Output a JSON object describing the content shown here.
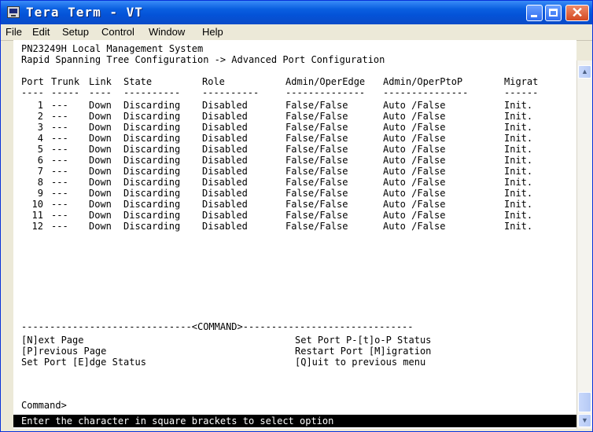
{
  "window": {
    "title": "Tera Term - VT"
  },
  "menubar": [
    "File",
    "Edit",
    "Setup",
    "Control",
    "Window",
    "Help"
  ],
  "terminal": {
    "header_line1": "PN23249H Local Management System",
    "header_line2": "Rapid Spanning Tree Configuration -> Advanced Port Configuration",
    "columns": {
      "port": "Port",
      "trunk": "Trunk",
      "link": "Link",
      "state": "State",
      "role": "Role",
      "edge": "Admin/OperEdge",
      "ptop": "Admin/OperPtoP",
      "migrat": "Migrat"
    },
    "underlines": {
      "port": "----",
      "trunk": "-----",
      "link": "----",
      "state": "----------",
      "role": "----------",
      "edge": "--------------",
      "ptop": "---------------",
      "migrat": "------"
    },
    "rows": [
      {
        "port": "1",
        "trunk": "---",
        "link": "Down",
        "state": "Discarding",
        "role": "Disabled",
        "edge": "False/False",
        "ptop": "Auto /False",
        "migrat": "Init."
      },
      {
        "port": "2",
        "trunk": "---",
        "link": "Down",
        "state": "Discarding",
        "role": "Disabled",
        "edge": "False/False",
        "ptop": "Auto /False",
        "migrat": "Init."
      },
      {
        "port": "3",
        "trunk": "---",
        "link": "Down",
        "state": "Discarding",
        "role": "Disabled",
        "edge": "False/False",
        "ptop": "Auto /False",
        "migrat": "Init."
      },
      {
        "port": "4",
        "trunk": "---",
        "link": "Down",
        "state": "Discarding",
        "role": "Disabled",
        "edge": "False/False",
        "ptop": "Auto /False",
        "migrat": "Init."
      },
      {
        "port": "5",
        "trunk": "---",
        "link": "Down",
        "state": "Discarding",
        "role": "Disabled",
        "edge": "False/False",
        "ptop": "Auto /False",
        "migrat": "Init."
      },
      {
        "port": "6",
        "trunk": "---",
        "link": "Down",
        "state": "Discarding",
        "role": "Disabled",
        "edge": "False/False",
        "ptop": "Auto /False",
        "migrat": "Init."
      },
      {
        "port": "7",
        "trunk": "---",
        "link": "Down",
        "state": "Discarding",
        "role": "Disabled",
        "edge": "False/False",
        "ptop": "Auto /False",
        "migrat": "Init."
      },
      {
        "port": "8",
        "trunk": "---",
        "link": "Down",
        "state": "Discarding",
        "role": "Disabled",
        "edge": "False/False",
        "ptop": "Auto /False",
        "migrat": "Init."
      },
      {
        "port": "9",
        "trunk": "---",
        "link": "Down",
        "state": "Discarding",
        "role": "Disabled",
        "edge": "False/False",
        "ptop": "Auto /False",
        "migrat": "Init."
      },
      {
        "port": "10",
        "trunk": "---",
        "link": "Down",
        "state": "Discarding",
        "role": "Disabled",
        "edge": "False/False",
        "ptop": "Auto /False",
        "migrat": "Init."
      },
      {
        "port": "11",
        "trunk": "---",
        "link": "Down",
        "state": "Discarding",
        "role": "Disabled",
        "edge": "False/False",
        "ptop": "Auto /False",
        "migrat": "Init."
      },
      {
        "port": "12",
        "trunk": "---",
        "link": "Down",
        "state": "Discarding",
        "role": "Disabled",
        "edge": "False/False",
        "ptop": "Auto /False",
        "migrat": "Init."
      }
    ],
    "command_divider": "------------------------------<COMMAND>------------------------------",
    "options_left": [
      "[N]ext Page",
      "[P]revious Page",
      "Set Port [E]dge Status"
    ],
    "options_right": [
      "Set Port P-[t]o-P Status",
      "Restart Port [M]igration",
      "[Q]uit to previous menu"
    ],
    "prompt": "Command>",
    "status": "Enter the character in square brackets to select option"
  },
  "colors": {
    "titlebar": "#0a5fe0",
    "status_bg": "#000000",
    "status_fg": "#ffffff"
  }
}
